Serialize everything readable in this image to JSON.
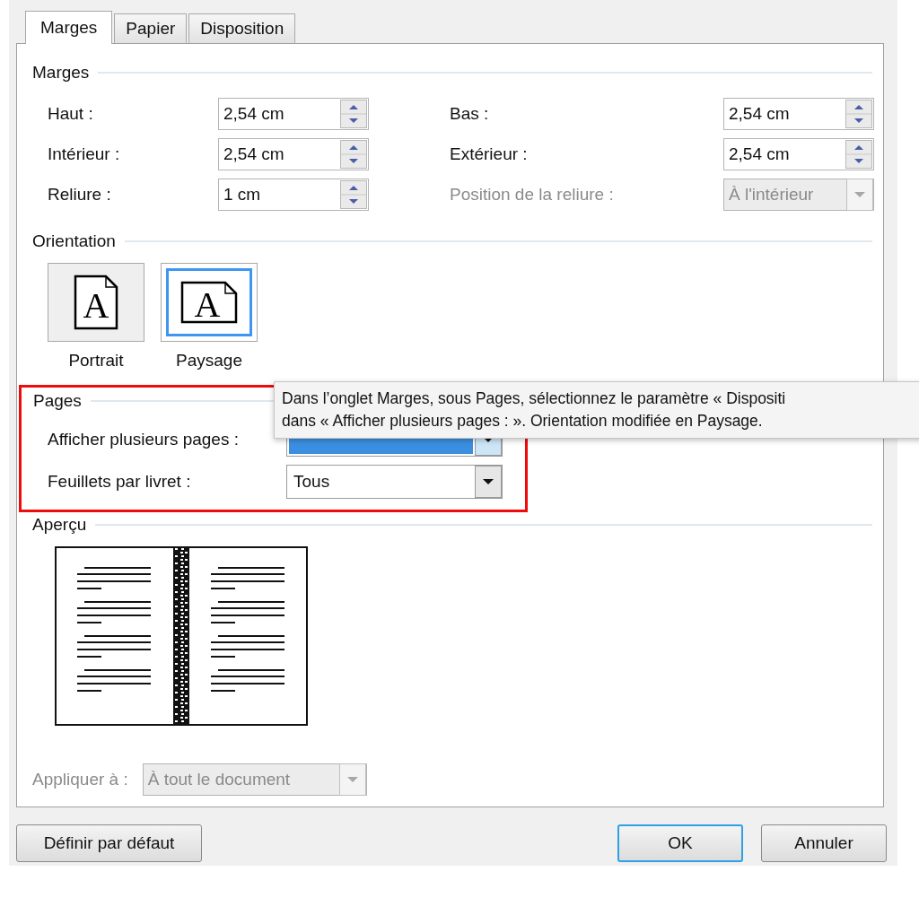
{
  "tabs": [
    {
      "label": "Marges",
      "selected": true
    },
    {
      "label": "Papier",
      "selected": false
    },
    {
      "label": "Disposition",
      "selected": false
    }
  ],
  "margins": {
    "title": "Marges",
    "fields": [
      {
        "label": "Haut :",
        "value": "2,54 cm",
        "kind": "spin",
        "disabled": false
      },
      {
        "label": "Bas :",
        "value": "2,54 cm",
        "kind": "spin",
        "disabled": false
      },
      {
        "label": "Intérieur :",
        "value": "2,54 cm",
        "kind": "spin",
        "disabled": false
      },
      {
        "label": "Extérieur :",
        "value": "2,54 cm",
        "kind": "spin",
        "disabled": false
      },
      {
        "label": "Reliure :",
        "value": "1 cm",
        "kind": "spin",
        "disabled": false
      },
      {
        "label": "Position de la reliure :",
        "value": "À l'intérieur",
        "kind": "dropdown",
        "disabled": true
      }
    ]
  },
  "orientation": {
    "title": "Orientation",
    "options": [
      {
        "label": "Portrait",
        "kind": "portrait",
        "glyph": "A",
        "selected": false
      },
      {
        "label": "Paysage",
        "kind": "landscape",
        "glyph": "A",
        "selected": true
      }
    ]
  },
  "pages": {
    "title": "Pages",
    "highlighted": true,
    "fields": [
      {
        "label": "Afficher plusieurs pages :",
        "focused": true
      },
      {
        "label": "Feuillets par livret :",
        "value": "Tous",
        "focused": false
      }
    ]
  },
  "preview": {
    "title": "Aperçu"
  },
  "apply": {
    "label": "Appliquer à :",
    "value": "À tout le document",
    "disabled": true
  },
  "buttons": [
    {
      "label": "Définir par défaut",
      "default": false
    },
    {
      "label": "OK",
      "default": true
    },
    {
      "label": "Annuler",
      "default": false
    }
  ],
  "tooltip": {
    "lines": [
      "Dans l’onglet Marges, sous Pages, sélectionnez le paramètre « Dispositi",
      "dans « Afficher plusieurs pages : ». Orientation modifiée en Paysage."
    ]
  }
}
